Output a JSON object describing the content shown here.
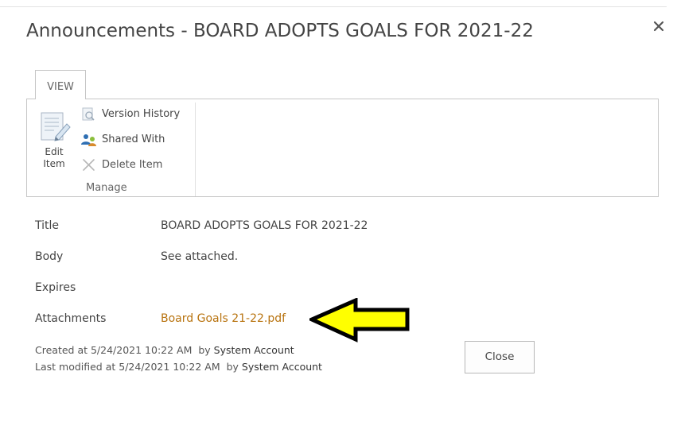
{
  "dialog": {
    "title": "Announcements - BOARD ADOPTS GOALS FOR 2021-22",
    "close_icon": "close-icon"
  },
  "ribbon": {
    "tab_label": "VIEW",
    "edit_item_label": "Edit Item",
    "version_history_label": "Version History",
    "shared_with_label": "Shared With",
    "delete_item_label": "Delete Item",
    "group_label": "Manage",
    "icons": {
      "edit": "edit-document-icon",
      "version_history": "version-history-icon",
      "shared_with": "shared-with-people-icon",
      "delete": "delete-x-icon"
    }
  },
  "fields": {
    "title_label": "Title",
    "title_value": "BOARD ADOPTS GOALS FOR 2021-22",
    "body_label": "Body",
    "body_value": "See attached.",
    "expires_label": "Expires",
    "expires_value": "",
    "attachments_label": "Attachments",
    "attachment_name": "Board Goals 21-22.pdf"
  },
  "meta": {
    "created_prefix": "Created at 5/24/2021 10:22 AM  by ",
    "created_by": "System Account",
    "modified_prefix": "Last modified at 5/24/2021 10:22 AM  by ",
    "modified_by": "System Account"
  },
  "buttons": {
    "close_label": "Close"
  },
  "colors": {
    "link": "#b8730f",
    "arrow_fill": "#ffff00"
  }
}
